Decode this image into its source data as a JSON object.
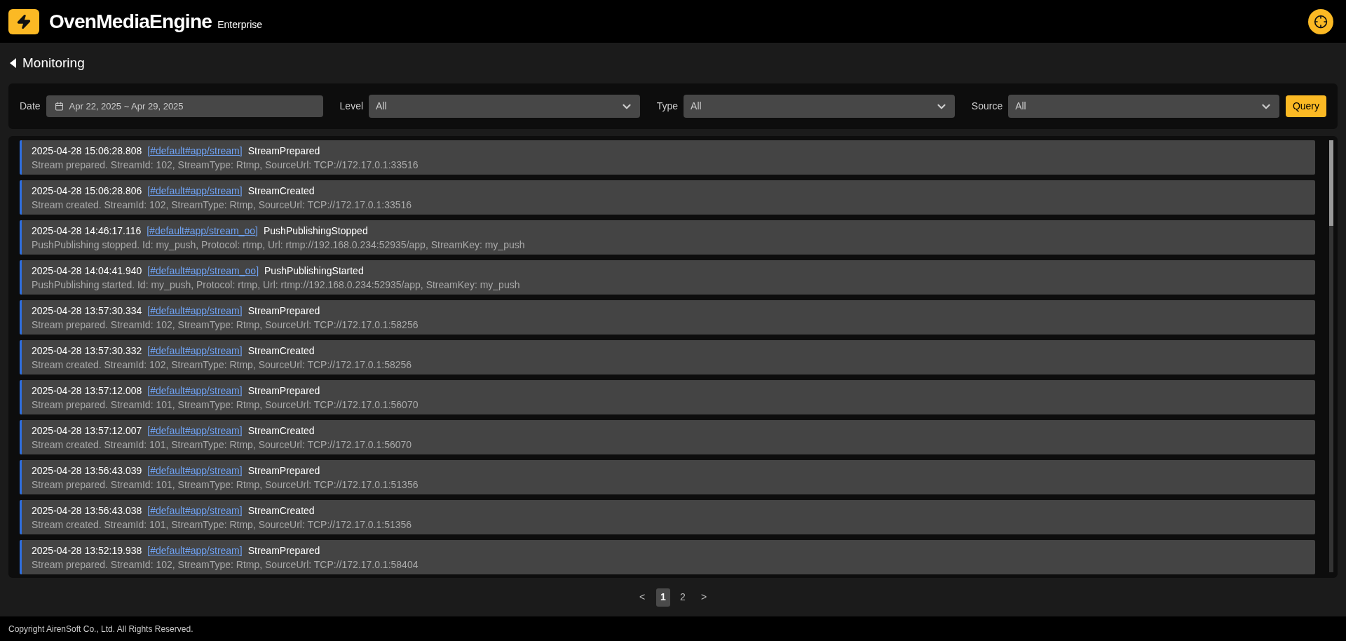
{
  "header": {
    "brand": "OvenMediaEngine",
    "edition": "Enterprise"
  },
  "page": {
    "title": "Monitoring"
  },
  "filters": {
    "date": {
      "label": "Date",
      "value": "Apr 22, 2025 ~ Apr 29, 2025"
    },
    "selects": [
      {
        "label": "Level",
        "value": "All"
      },
      {
        "label": "Type",
        "value": "All"
      },
      {
        "label": "Source",
        "value": "All"
      }
    ],
    "query_button": "Query"
  },
  "logs": [
    {
      "time": "2025-04-28 15:06:28.808",
      "source": "[#default#app/stream]",
      "event": "StreamPrepared",
      "message": "Stream prepared. StreamId: 102, StreamType: Rtmp, SourceUrl: TCP://172.17.0.1:33516"
    },
    {
      "time": "2025-04-28 15:06:28.806",
      "source": "[#default#app/stream]",
      "event": "StreamCreated",
      "message": "Stream created. StreamId: 102, StreamType: Rtmp, SourceUrl: TCP://172.17.0.1:33516"
    },
    {
      "time": "2025-04-28 14:46:17.116",
      "source": "[#default#app/stream_oo]",
      "event": "PushPublishingStopped",
      "message": "PushPublishing stopped. Id: my_push, Protocol: rtmp, Url: rtmp://192.168.0.234:52935/app, StreamKey: my_push"
    },
    {
      "time": "2025-04-28 14:04:41.940",
      "source": "[#default#app/stream_oo]",
      "event": "PushPublishingStarted",
      "message": "PushPublishing started. Id: my_push, Protocol: rtmp, Url: rtmp://192.168.0.234:52935/app, StreamKey: my_push"
    },
    {
      "time": "2025-04-28 13:57:30.334",
      "source": "[#default#app/stream]",
      "event": "StreamPrepared",
      "message": "Stream prepared. StreamId: 102, StreamType: Rtmp, SourceUrl: TCP://172.17.0.1:58256"
    },
    {
      "time": "2025-04-28 13:57:30.332",
      "source": "[#default#app/stream]",
      "event": "StreamCreated",
      "message": "Stream created. StreamId: 102, StreamType: Rtmp, SourceUrl: TCP://172.17.0.1:58256"
    },
    {
      "time": "2025-04-28 13:57:12.008",
      "source": "[#default#app/stream]",
      "event": "StreamPrepared",
      "message": "Stream prepared. StreamId: 101, StreamType: Rtmp, SourceUrl: TCP://172.17.0.1:56070"
    },
    {
      "time": "2025-04-28 13:57:12.007",
      "source": "[#default#app/stream]",
      "event": "StreamCreated",
      "message": "Stream created. StreamId: 101, StreamType: Rtmp, SourceUrl: TCP://172.17.0.1:56070"
    },
    {
      "time": "2025-04-28 13:56:43.039",
      "source": "[#default#app/stream]",
      "event": "StreamPrepared",
      "message": "Stream prepared. StreamId: 101, StreamType: Rtmp, SourceUrl: TCP://172.17.0.1:51356"
    },
    {
      "time": "2025-04-28 13:56:43.038",
      "source": "[#default#app/stream]",
      "event": "StreamCreated",
      "message": "Stream created. StreamId: 101, StreamType: Rtmp, SourceUrl: TCP://172.17.0.1:51356"
    },
    {
      "time": "2025-04-28 13:52:19.938",
      "source": "[#default#app/stream]",
      "event": "StreamPrepared",
      "message": "Stream prepared. StreamId: 102, StreamType: Rtmp, SourceUrl: TCP://172.17.0.1:58404"
    }
  ],
  "pagination": {
    "prev": "<",
    "pages": [
      {
        "label": "1",
        "selected": true
      },
      {
        "label": "2",
        "selected": false
      }
    ],
    "next": ">"
  },
  "footer": "Copyright AirenSoft Co., Ltd. All Rights Reserved."
}
